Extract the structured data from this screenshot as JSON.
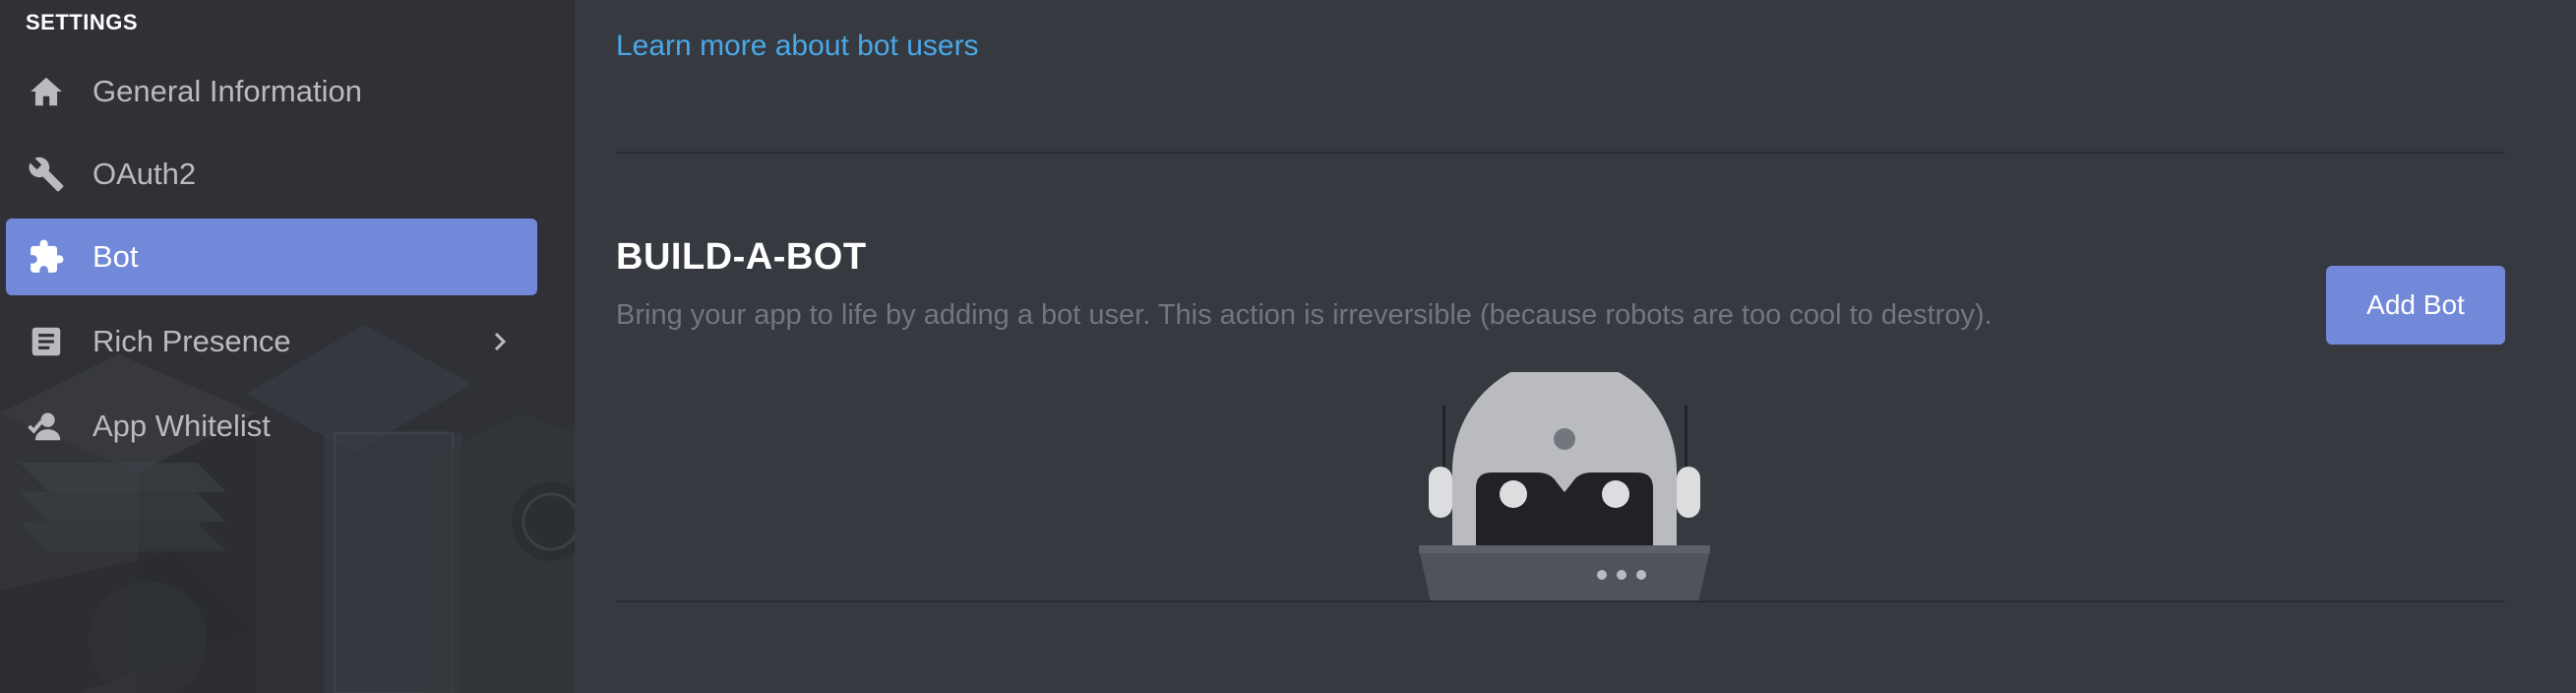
{
  "sidebar": {
    "heading": "SETTINGS",
    "items": [
      {
        "label": "General Information",
        "icon": "home-icon",
        "active": false
      },
      {
        "label": "OAuth2",
        "icon": "wrench-icon",
        "active": false
      },
      {
        "label": "Bot",
        "icon": "puzzle-piece-icon",
        "active": true
      },
      {
        "label": "Rich Presence",
        "icon": "document-icon",
        "active": false,
        "has_submenu": true
      },
      {
        "label": "App Whitelist",
        "icon": "user-check-icon",
        "active": false
      }
    ]
  },
  "main": {
    "learn_link": "Learn more about bot users",
    "build_section": {
      "title": "BUILD-A-BOT",
      "description": "Bring your app to life by adding a bot user. This action is irreversible (because robots are too cool to destroy).",
      "button_label": "Add Bot"
    }
  },
  "colors": {
    "background": "#36393f",
    "sidebar": "#2f3136",
    "accent": "#7289da",
    "link": "#4aa8e8",
    "muted_text": "#72767d"
  }
}
